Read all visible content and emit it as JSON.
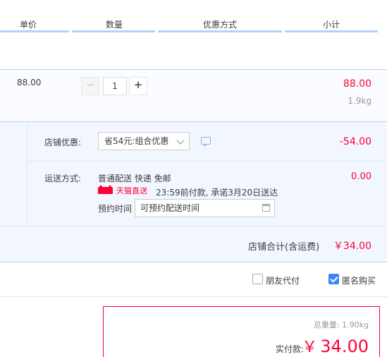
{
  "header": {
    "col_price": "单价",
    "col_qty": "数量",
    "col_promo": "优惠方式",
    "col_subtotal": "小计"
  },
  "item": {
    "unit_price": "88.00",
    "quantity": "1",
    "minus_symbol": "−",
    "plus_symbol": "+",
    "subtotal": "88.00",
    "weight": "1.9kg"
  },
  "promo": {
    "label": "店铺优惠:",
    "selected": "省54元:组合优惠",
    "amount": "-54.00"
  },
  "shipping": {
    "label": "运送方式:",
    "method": "普通配送 快递 免邮",
    "badge": "天猫直送",
    "promise": "23:59前付款, 承诺3月20日送达",
    "schedule_label": "预约时间",
    "schedule_placeholder": "可预约配送时间",
    "fee": "0.00"
  },
  "store_total": {
    "label": "店铺合计(含运费)",
    "amount": "￥34.00"
  },
  "options": {
    "friend_pay_label": "朋友代付",
    "friend_pay_checked": false,
    "anonymous_label": "匿名购买",
    "anonymous_checked": true
  },
  "summary": {
    "total_weight_label": "总重量:",
    "total_weight": "1.90kg",
    "paid_label": "实付款:",
    "currency": "￥",
    "paid_amount": "34.00"
  },
  "colors": {
    "accent_red": "#ff0036",
    "accent_blue": "#3d86f6",
    "header_line": "#b2d1ff",
    "panel_bg": "#f2f7ff"
  },
  "icons": [
    "chevron-down-icon",
    "message-icon",
    "tmall-logo-icon",
    "calendar-icon",
    "checkbox-icon",
    "checkmark-icon"
  ]
}
